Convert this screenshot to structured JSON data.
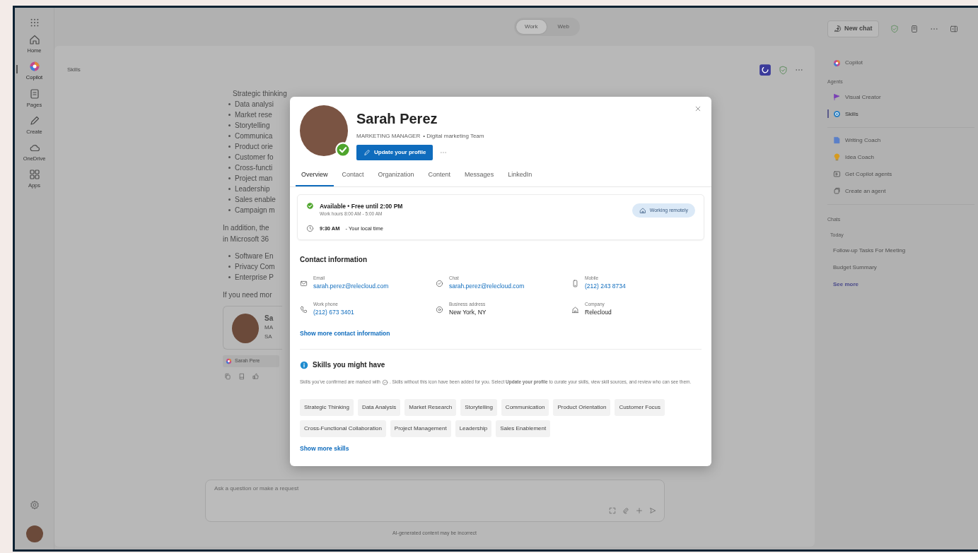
{
  "app_rail": [
    {
      "label": "Home",
      "kind": "home",
      "selected": false
    },
    {
      "label": "Copilot",
      "kind": "copilot",
      "selected": true
    },
    {
      "label": "Pages",
      "kind": "pages",
      "selected": false
    },
    {
      "label": "Create",
      "kind": "pen",
      "selected": false
    },
    {
      "label": "OneDrive",
      "kind": "cloud",
      "selected": false
    },
    {
      "label": "Apps",
      "kind": "apps",
      "selected": false
    }
  ],
  "mode_toggle": [
    {
      "label": "Work",
      "selected": true
    },
    {
      "label": "Web",
      "selected": false
    }
  ],
  "new_chat": "New chat",
  "chat": {
    "title": "Skills",
    "bullets_1": [
      "Strategic thinking",
      "Data analysi",
      "Market rese",
      "Storytelling",
      "Communica",
      "Product orie",
      "Customer fo",
      "Cross-functi",
      "Project man",
      "Leadership",
      "Sales enable",
      "Campaign m"
    ],
    "paragraph_1": [
      "In addition, the",
      "in Microsoft 36"
    ],
    "bullets_2": [
      "Software En",
      "Privacy Com",
      "Enterprise P"
    ],
    "paragraph_2": "If you need mor",
    "person_card": [
      "Sa",
      "MA",
      "SA"
    ],
    "reference_chip": "Sarah Pere",
    "input": {
      "placeholder": "Ask a question or make a request"
    },
    "disclaimer": "AI-generated content may be incorrect"
  },
  "profile_card": {
    "name": "Sarah Perez",
    "title": "MARKETING MANAGER",
    "team": "• Digital marketing Team",
    "update_button": "Update your profile",
    "tabs": [
      {
        "label": "Overview",
        "selected": true
      },
      {
        "label": "Contact",
        "selected": false
      },
      {
        "label": "Organization",
        "selected": false
      },
      {
        "label": "Content",
        "selected": false
      },
      {
        "label": "Messages",
        "selected": false
      },
      {
        "label": "LinkedIn",
        "selected": false
      }
    ],
    "availability": {
      "status": "Available • Free until 2:00 PM",
      "hours": "Work hours 8:00 AM - 5:00 AM",
      "local_time": "9:30 AM",
      "local_label": "- Your local time",
      "location": "Working remotely"
    },
    "contact": {
      "heading": "Contact information",
      "fields": [
        {
          "label": "Email",
          "value": "sarah.perez@relecloud.com",
          "kind": "mail",
          "link": true
        },
        {
          "label": "Chat",
          "value": "sarah.perez@relecloud.com",
          "kind": "chat",
          "link": true
        },
        {
          "label": "Mobile",
          "value": "(212) 243 8734",
          "kind": "mobile",
          "link": true
        },
        {
          "label": "Work phone",
          "value": "(212) 673 3401",
          "kind": "phone",
          "link": true
        },
        {
          "label": "Business address",
          "value": "New York, NY",
          "kind": "pin",
          "link": false
        },
        {
          "label": "Company",
          "value": "Relecloud",
          "kind": "building",
          "link": false
        }
      ],
      "show_more": "Show more contact information"
    },
    "skills": {
      "heading": "Skills you might have",
      "note_before": "Skills you've confirmed are marked with",
      "note_after": ". Skills without this icon have been added for you. Select **Update your profile** to curate your skills, view skill sources, and review who can see them.",
      "items": [
        "Strategic Thinking",
        "Data Analysis",
        "Market Research",
        "Storytelling",
        "Communication",
        "Product Orientation",
        "Customer Focus",
        "Cross-Functional Collaboration",
        "Project Management",
        "Leadership",
        "Sales Enablement"
      ],
      "show_more": "Show more skills"
    }
  },
  "sidebar": {
    "copilot": "Copilot",
    "agents_heading": "Agents",
    "agents": [
      {
        "label": "Visual Creator",
        "kind": "flag",
        "selected": false
      },
      {
        "label": "Skills",
        "kind": "ring",
        "selected": true
      }
    ],
    "more_agents": [
      {
        "label": "Writing Coach",
        "kind": "doc"
      },
      {
        "label": "Idea Coach",
        "kind": "bulb"
      },
      {
        "label": "Get Copilot agents",
        "kind": "store"
      },
      {
        "label": "Create an agent",
        "kind": "build"
      }
    ],
    "chats_heading": "Chats",
    "chats_group": "Today",
    "chats": [
      "Follow-up Tasks For Meeting",
      "Budget Summary"
    ],
    "see_more": "See more"
  }
}
